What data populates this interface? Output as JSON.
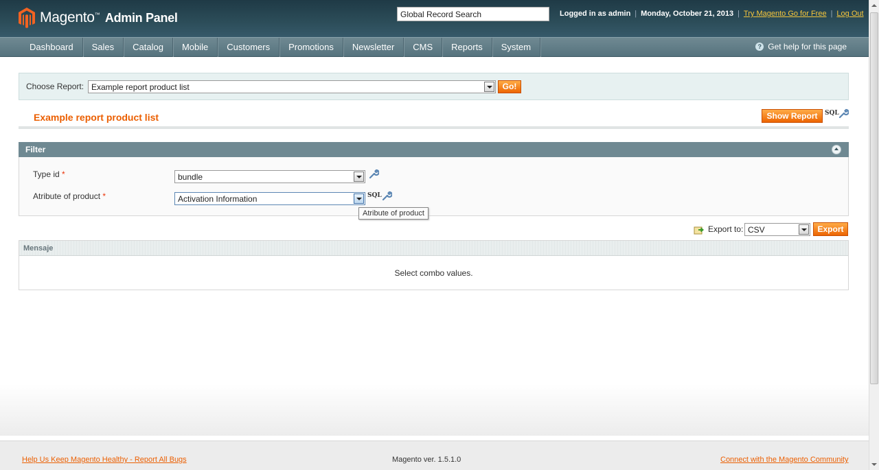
{
  "header": {
    "logo_text": "Magento",
    "logo_sub": "Admin Panel",
    "search_value": "Global Record Search",
    "logged_in": "Logged in as admin",
    "date": "Monday, October 21, 2013",
    "try_link": "Try Magento Go for Free",
    "logout": "Log Out",
    "separator": "|"
  },
  "nav": {
    "items": [
      "Dashboard",
      "Sales",
      "Catalog",
      "Mobile",
      "Customers",
      "Promotions",
      "Newsletter",
      "CMS",
      "Reports",
      "System"
    ],
    "help": "Get help for this page"
  },
  "choose_report": {
    "label": "Choose Report:",
    "selected": "Example report product list",
    "go": "Go!"
  },
  "report": {
    "title": "Example report product list",
    "show_button": "Show Report",
    "sql": "SQL"
  },
  "filter": {
    "title": "Filter",
    "fields": [
      {
        "label": "Type id",
        "required": "*",
        "value": "bundle"
      },
      {
        "label": "Atribute of product",
        "required": "*",
        "value": "Activation Information"
      }
    ],
    "sql": "SQL",
    "tooltip": "Atribute of product"
  },
  "export": {
    "label": "Export to:",
    "format": "CSV",
    "button": "Export"
  },
  "grid": {
    "header": "Mensaje",
    "message": "Select combo values."
  },
  "footer": {
    "bugs_link": "Help Us Keep Magento Healthy - Report All Bugs",
    "version": "Magento ver. 1.5.1.0",
    "community_link": "Connect with the Magento Community"
  },
  "colors": {
    "accent": "#eb5e00",
    "header_bg": "#2c4d59",
    "nav_bg": "#6f8992"
  }
}
